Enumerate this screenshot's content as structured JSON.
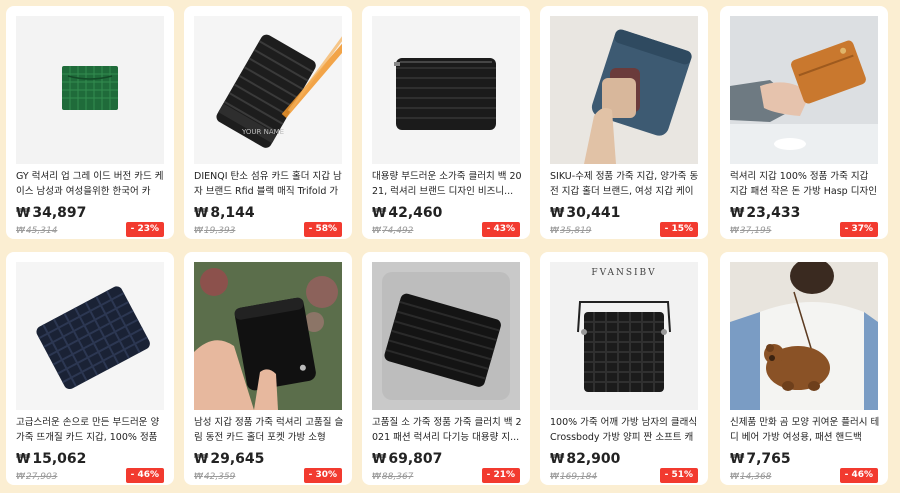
{
  "currency_symbol": "₩",
  "products": [
    {
      "title": "GY 럭셔리 업 그레 이드 버전 카드 케이스 남성과 여성을위한 한국어 카드...",
      "price": "34,897",
      "original_price": "45,314",
      "discount": "- 23%",
      "image": "green-card-holder"
    },
    {
      "title": "DIENQI 탄소 섬유 카드 홀더 지갑 남자 브랜드 Rfid 블랙 매직 Trifold 가죽 ...",
      "price": "8,144",
      "original_price": "19,393",
      "discount": "- 58%",
      "image": "carbon-fiber-wallet"
    },
    {
      "title": "대용량 부드러운 소가죽 클러치 백 2021, 럭셔리 브랜드 디자인 비즈니...",
      "price": "42,460",
      "original_price": "74,492",
      "discount": "- 43%",
      "image": "woven-clutch"
    },
    {
      "title": "SIKU-수제 정품 가죽 지갑, 양가죽 동전 지갑 홀더 브랜드, 여성 지갑 케이스",
      "price": "30,441",
      "original_price": "35,819",
      "discount": "- 15%",
      "image": "blue-pouch"
    },
    {
      "title": "럭셔리 지갑 100% 정품 가죽 지갑 지갑 패션 작은 돈 가방 Hasp 디자인 지...",
      "price": "23,433",
      "original_price": "37,195",
      "discount": "- 37%",
      "image": "tan-wallet"
    },
    {
      "title": "고급스러운 손으로 만든 부드러운 양가죽 뜨개질 카드 지갑, 100% 정품 ...",
      "price": "15,062",
      "original_price": "27,903",
      "discount": "- 46%",
      "image": "navy-woven-wallet"
    },
    {
      "title": "남성 지갑 정품 가죽 럭셔리 고품질 슬림 동전 카드 홀더 포켓 가방 소형 블...",
      "price": "29,645",
      "original_price": "42,359",
      "discount": "- 30%",
      "image": "black-wallet-hand"
    },
    {
      "title": "고품질 소 가죽 정품 가죽 클러치 백 2021 패션 럭셔리 다기능 대용량 지...",
      "price": "69,807",
      "original_price": "88,367",
      "discount": "- 21%",
      "image": "black-clutch-chair"
    },
    {
      "title": "100% 가죽 어깨 가방 남자의 클래식 Crossbody 가방 양피 짠 소프트 캐주...",
      "price": "82,900",
      "original_price": "169,184",
      "discount": "- 51%",
      "image": "woven-shoulder-bag",
      "brand_text": "FVANSIBV"
    },
    {
      "title": "신제품 만화 곰 모양 귀여운 플러시 테디 베어 가방 여성용, 패션 핸드백 휴...",
      "price": "7,765",
      "original_price": "14,368",
      "discount": "- 46%",
      "image": "teddy-bear-bag"
    }
  ]
}
